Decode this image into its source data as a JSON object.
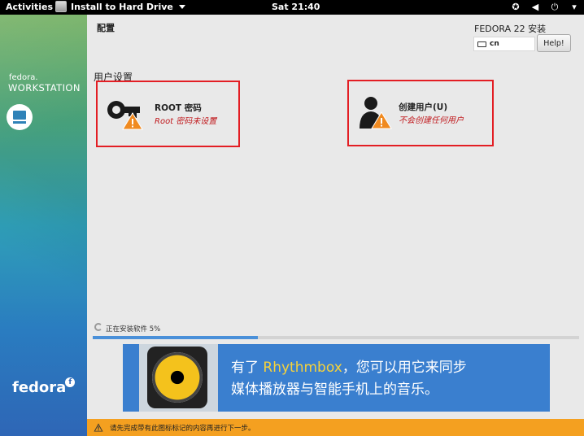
{
  "topbar": {
    "activities": "Activities",
    "app_name": "Install to Hard Drive",
    "clock": "Sat 21:40"
  },
  "sidebar": {
    "brand_small": "fedora.",
    "brand_workstation": "WORKSTATION",
    "logo_text": "fedora",
    "logo_mark": "f"
  },
  "header": {
    "title": "配置",
    "product": "FEDORA 22 安装",
    "keyboard_layout": "cn",
    "help_label": "Help!"
  },
  "section": {
    "title": "用户设置"
  },
  "spokes": {
    "root": {
      "label": "ROOT 密码",
      "status": "Root 密码未设置"
    },
    "user": {
      "label": "创建用户(U)",
      "status": "不会创建任何用户"
    }
  },
  "progress": {
    "label": "正在安装软件 5%",
    "fraction": 0.34
  },
  "banner": {
    "line1_prefix": "有了 ",
    "line1_highlight": "Rhythmbox",
    "line1_suffix": "，您可以用它来同步",
    "line2": "媒体播放器与智能手机上的音乐。"
  },
  "warning": {
    "text": "请先完成带有此图标标记的内容再进行下一步。"
  },
  "colors": {
    "accent": "#4a90d9",
    "spoke_border": "#e31e24",
    "warning_bar": "#f4a020",
    "status_red": "#c0181c"
  }
}
